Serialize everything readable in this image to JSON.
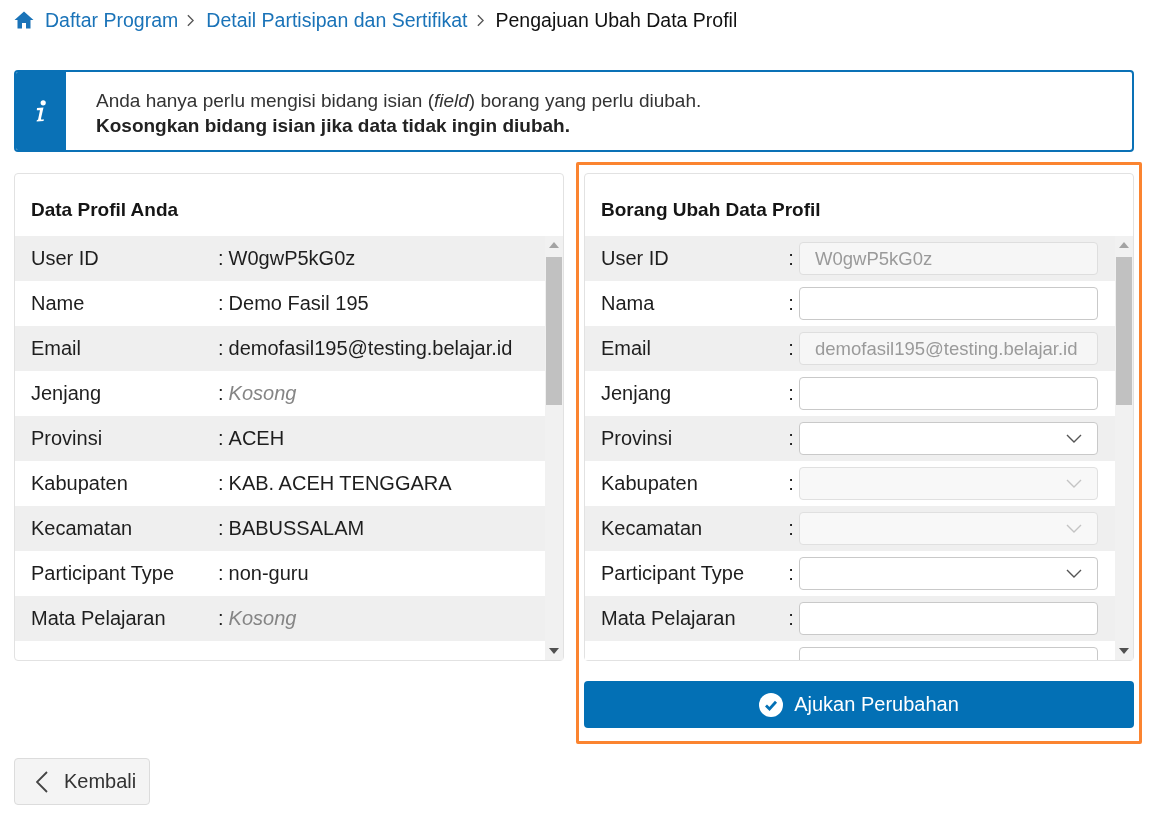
{
  "breadcrumb": [
    {
      "label": "Daftar Program",
      "current": false
    },
    {
      "label": "Detail Partisipan dan Sertifikat",
      "current": false
    },
    {
      "label": "Pengajuan Ubah Data Profil",
      "current": true
    }
  ],
  "notice": {
    "message": "Anda hanya perlu mengisi bidang isian (*field*) borang yang perlu diubah.",
    "emphasis": "Kosongkan bidang isian jika data tidak ingin diubah."
  },
  "profile_panel": {
    "title": "Data Profil Anda",
    "rows": [
      {
        "label": "User ID",
        "separator": ":",
        "value": "W0gwP5kG0z",
        "empty": false
      },
      {
        "label": "Name",
        "separator": ":",
        "value": "Demo Fasil 195",
        "empty": false
      },
      {
        "label": "Email",
        "separator": ":",
        "value": "demofasil195@testing.belajar.id",
        "empty": false
      },
      {
        "label": "Jenjang",
        "separator": ":",
        "value": "Kosong",
        "empty": true
      },
      {
        "label": "Provinsi",
        "separator": ":",
        "value": "ACEH",
        "empty": false
      },
      {
        "label": "Kabupaten",
        "separator": ":",
        "value": "KAB. ACEH TENGGARA",
        "empty": false
      },
      {
        "label": "Kecamatan",
        "separator": ":",
        "value": "BABUSSALAM",
        "empty": false
      },
      {
        "label": "Participant Type",
        "separator": ":",
        "value": "non-guru",
        "empty": false
      },
      {
        "label": "Mata Pelajaran",
        "separator": ":",
        "value": "Kosong",
        "empty": true
      }
    ]
  },
  "form_panel": {
    "title": "Borang Ubah Data Profil",
    "highlighted": true,
    "fields": [
      {
        "label": "User ID",
        "separator": ":",
        "kind": "text",
        "value": "W0gwP5kG0z",
        "disabled": true
      },
      {
        "label": "Nama",
        "separator": ":",
        "kind": "text",
        "disabled": false
      },
      {
        "label": "Email",
        "separator": ":",
        "kind": "text",
        "value": "demofasil195@testing.belajar.id",
        "disabled": true
      },
      {
        "label": "Jenjang",
        "separator": ":",
        "kind": "text",
        "disabled": false
      },
      {
        "label": "Provinsi",
        "separator": ":",
        "kind": "select",
        "disabled": false
      },
      {
        "label": "Kabupaten",
        "separator": ":",
        "kind": "select",
        "disabled": true
      },
      {
        "label": "Kecamatan",
        "separator": ":",
        "kind": "select",
        "disabled": true
      },
      {
        "label": "Participant Type",
        "separator": ":",
        "kind": "select",
        "disabled": false
      },
      {
        "label": "Mata Pelajaran",
        "separator": ":",
        "kind": "text",
        "disabled": false
      },
      {
        "kind": "text",
        "disabled": false
      }
    ],
    "submit_button": {
      "label": "Ajukan Perubahan"
    }
  },
  "back_button": {
    "label": "Kembali"
  }
}
